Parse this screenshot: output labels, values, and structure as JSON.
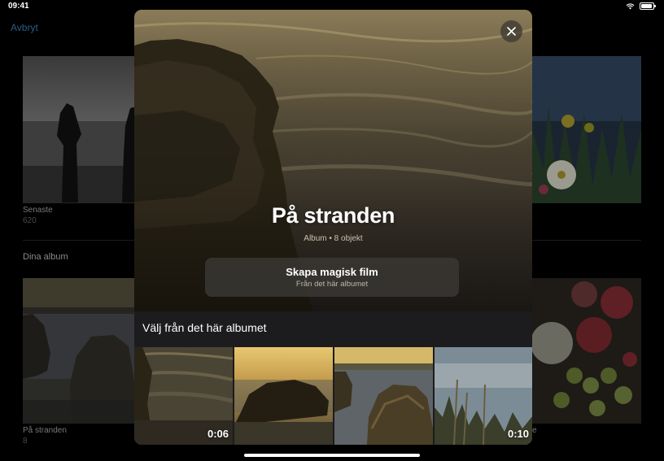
{
  "status_bar": {
    "time": "09:41",
    "battery_level": 0.95
  },
  "background": {
    "cancel_label": "Avbryt",
    "recent": {
      "title": "Senaste",
      "count": "620"
    },
    "section_title": "Dina album",
    "album": {
      "title": "På stranden",
      "count": "8"
    },
    "partial_caption": "e"
  },
  "sheet": {
    "title": "På stranden",
    "meta": "Album • 8 objekt",
    "magic": {
      "label": "Skapa magisk film",
      "sublabel": "Från det här albumet"
    },
    "pick_heading": "Välj från det här albumet",
    "items": [
      {
        "duration": "0:06"
      },
      {
        "duration": ""
      },
      {
        "duration": ""
      },
      {
        "duration": "0:10"
      }
    ]
  },
  "icons": {
    "close": "close-icon",
    "wifi": "wifi-icon",
    "battery": "battery-icon"
  },
  "colors": {
    "accent": "#2c5c86",
    "sheet_bg": "#1c1c1e"
  }
}
